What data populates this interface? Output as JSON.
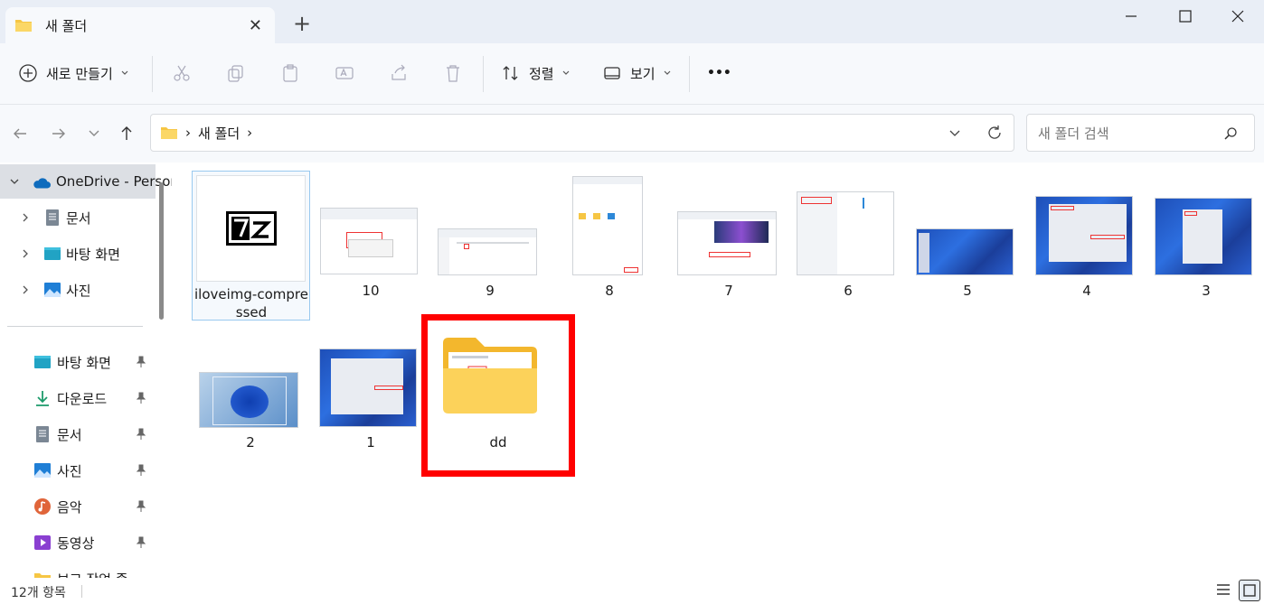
{
  "window": {
    "tab_title": "새 폴더",
    "tab_close": "✕",
    "new_tab": "+"
  },
  "toolbar": {
    "new_label": "새로 만들기",
    "sort_label": "정렬",
    "view_label": "보기",
    "more_label": "•••"
  },
  "address": {
    "folder": "새 폴더",
    "separator": "›",
    "search_placeholder": "새 폴더 검색"
  },
  "sidebar": {
    "tree": [
      {
        "label": "OneDrive - Personal",
        "expanded": true
      },
      {
        "label": "문서"
      },
      {
        "label": "바탕 화면"
      },
      {
        "label": "사진"
      }
    ],
    "quick_access": [
      {
        "label": "바탕 화면"
      },
      {
        "label": "다운로드"
      },
      {
        "label": "문서"
      },
      {
        "label": "사진"
      },
      {
        "label": "음악"
      },
      {
        "label": "동영상"
      },
      {
        "label": "보고 작업 종"
      }
    ]
  },
  "items": [
    {
      "name": "iloveimg-compressed",
      "line1": "iloveimg-compre",
      "line2": "ssed",
      "kind": "7z-archive",
      "selected": true
    },
    {
      "name": "10",
      "kind": "screenshot"
    },
    {
      "name": "9",
      "kind": "screenshot"
    },
    {
      "name": "8",
      "kind": "screenshot"
    },
    {
      "name": "7",
      "kind": "screenshot"
    },
    {
      "name": "6",
      "kind": "screenshot"
    },
    {
      "name": "5",
      "kind": "wallpaper"
    },
    {
      "name": "4",
      "kind": "wallpaper"
    },
    {
      "name": "3",
      "kind": "wallpaper"
    },
    {
      "name": "2",
      "kind": "wallpaper"
    },
    {
      "name": "1",
      "kind": "wallpaper"
    },
    {
      "name": "dd",
      "kind": "folder",
      "highlighted": true
    }
  ],
  "status": {
    "count": "12개 항목"
  },
  "colors": {
    "accent": "#0067c0",
    "highlight": "#ff0000",
    "folder": "#f6c644"
  }
}
